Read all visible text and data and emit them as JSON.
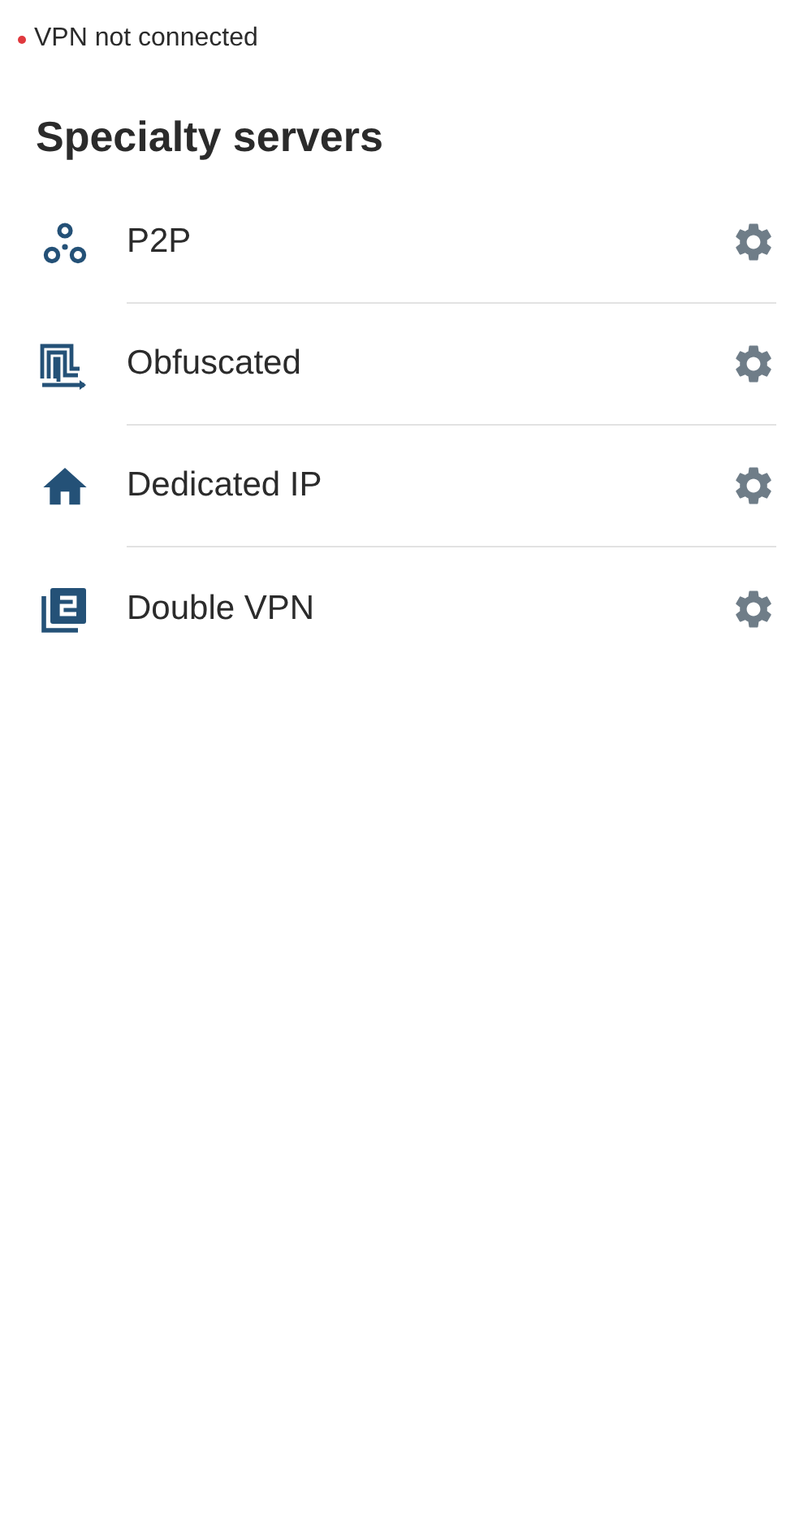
{
  "status": {
    "connected": false,
    "label": "VPN not connected"
  },
  "title": "Specialty servers",
  "servers": [
    {
      "kind": "p2p",
      "label": "P2P"
    },
    {
      "kind": "obfuscated",
      "label": "Obfuscated"
    },
    {
      "kind": "dedicated",
      "label": "Dedicated IP"
    },
    {
      "kind": "double",
      "label": "Double VPN"
    }
  ]
}
